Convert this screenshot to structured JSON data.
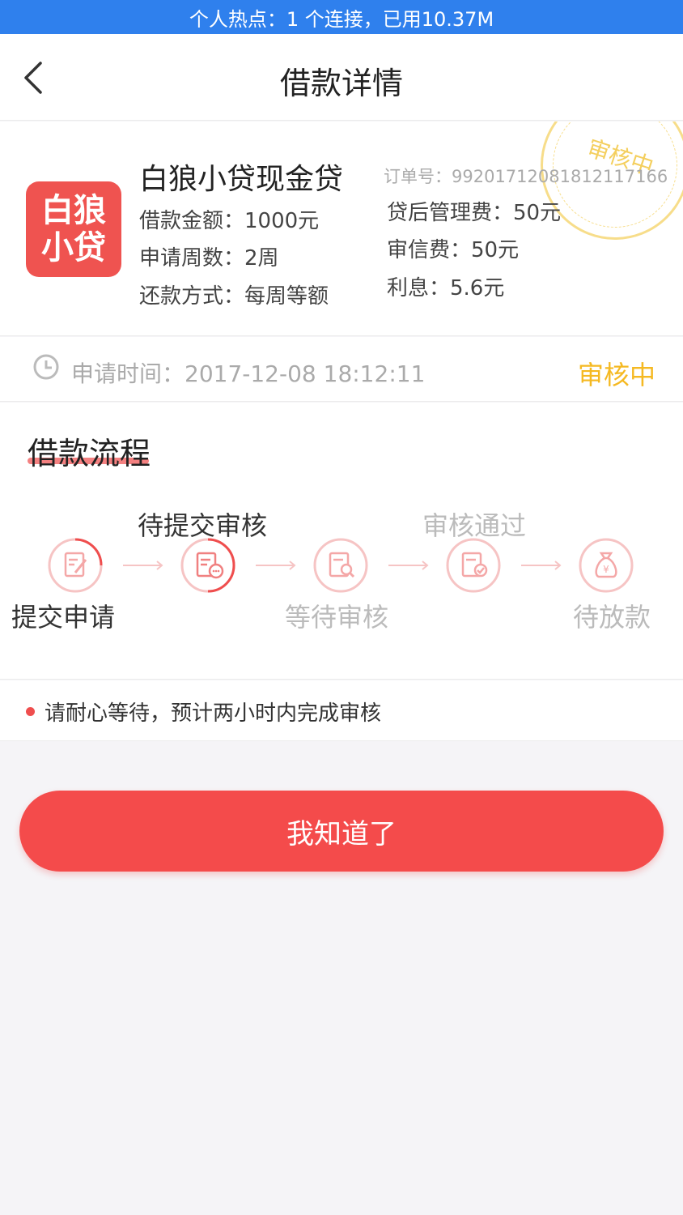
{
  "status_bar": {
    "text": "个人热点：1 个连接，已用10.37M"
  },
  "header": {
    "title": "借款详情",
    "back_icon": "chevron-left-icon"
  },
  "loan": {
    "logo_lines": [
      "白狼",
      "小贷"
    ],
    "product_name": "白狼小贷现金贷",
    "order_no": "订单号：99201712081812117166",
    "amount": "借款金额：1000元",
    "weeks": "申请周数：2周",
    "repay_method": "还款方式：每周等额",
    "mgmt_fee": "贷后管理费：50元",
    "review_fee": "审信费：50元",
    "interest": "利息：5.6元",
    "stamp": "审核中"
  },
  "application": {
    "time": "申请时间：2017-12-08 18:12:11",
    "status": "审核中",
    "status_color": "#f5b922"
  },
  "process": {
    "title": "借款流程",
    "steps": [
      {
        "label": "提交申请",
        "icon": "edit-document-icon"
      },
      {
        "label": "待提交审核",
        "icon": "document-chat-icon"
      },
      {
        "label": "等待审核",
        "icon": "document-search-icon"
      },
      {
        "label": "审核通过",
        "icon": "document-check-icon"
      },
      {
        "label": "待放款",
        "icon": "money-bag-icon"
      }
    ]
  },
  "tip": {
    "text": "请耐心等待，预计两小时内完成审核"
  },
  "action": {
    "confirm_label": "我知道了"
  },
  "colors": {
    "accent": "#f44b4b",
    "status_bar": "#2f80ed",
    "pending": "#f5b922"
  }
}
